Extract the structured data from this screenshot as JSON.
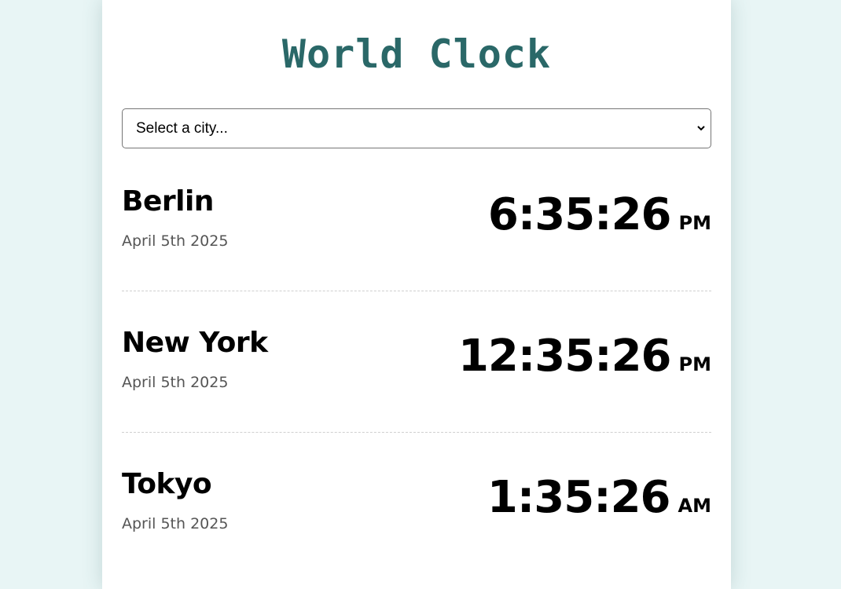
{
  "header": {
    "title": "World Clock"
  },
  "city_select": {
    "placeholder": "Select a city..."
  },
  "cities": [
    {
      "name": "Berlin",
      "date": "April 5th 2025",
      "time": "6:35:26",
      "ampm": "PM"
    },
    {
      "name": "New York",
      "date": "April 5th 2025",
      "time": "12:35:26",
      "ampm": "PM"
    },
    {
      "name": "Tokyo",
      "date": "April 5th 2025",
      "time": "1:35:26",
      "ampm": "AM"
    }
  ],
  "colors": {
    "background": "#e8f5f5",
    "title": "#2a6868",
    "card": "#ffffff",
    "date_text": "#555555"
  }
}
